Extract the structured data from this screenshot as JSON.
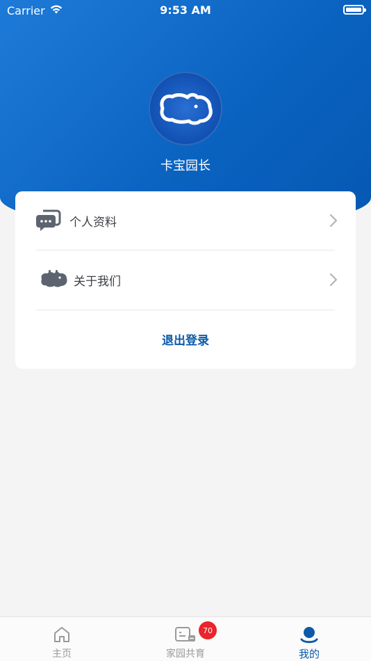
{
  "status_bar": {
    "carrier": "Carrier",
    "time": "9:53 AM"
  },
  "profile": {
    "username": "卡宝园长"
  },
  "menu": {
    "items": [
      {
        "label": "个人资料",
        "icon": "chat-bubbles-icon"
      },
      {
        "label": "关于我们",
        "icon": "hippo-icon"
      }
    ],
    "logout_label": "退出登录"
  },
  "tabbar": {
    "tabs": [
      {
        "label": "主页",
        "icon": "home-icon",
        "active": false
      },
      {
        "label": "家园共育",
        "icon": "family-card-icon",
        "active": false,
        "badge": "70"
      },
      {
        "label": "我的",
        "icon": "user-icon",
        "active": true
      }
    ]
  },
  "colors": {
    "header_gradient_start": "#1e7ad8",
    "header_gradient_end": "#0558b2",
    "accent": "#0c5aa8",
    "badge": "#e8262b",
    "icon_gray": "#5d6470"
  }
}
